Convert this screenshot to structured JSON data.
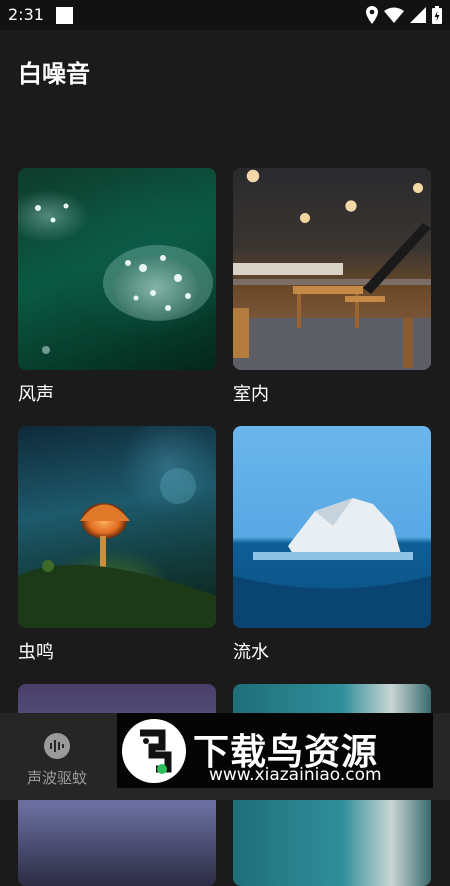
{
  "status_bar": {
    "time": "2:31"
  },
  "page": {
    "title": "白噪音"
  },
  "cards": [
    {
      "label": "风声"
    },
    {
      "label": "室内"
    },
    {
      "label": "虫鸣"
    },
    {
      "label": "流水"
    }
  ],
  "bottom_nav": {
    "items": [
      {
        "label": "声波驱蚊",
        "icon": "sound-wave-icon"
      }
    ]
  },
  "watermark": {
    "brand": "下载鸟资源",
    "url": "www.xiazainiao.com"
  }
}
